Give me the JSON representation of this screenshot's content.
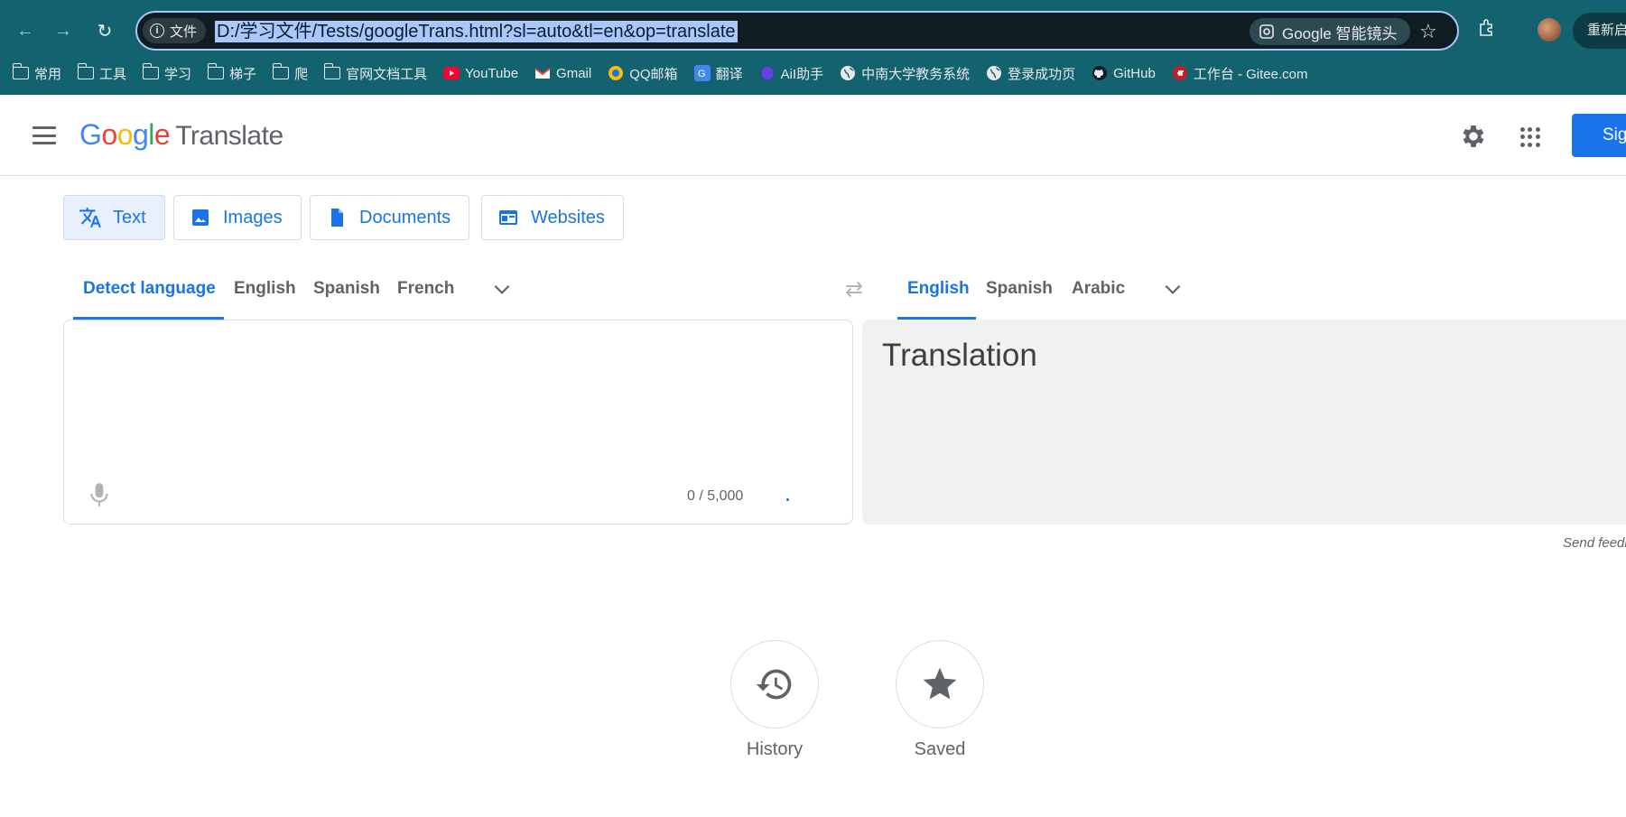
{
  "browser": {
    "url": "D:/学习文件/Tests/googleTrans.html?sl=auto&tl=en&op=translate",
    "site_chip_label": "文件",
    "lens_label": "Google 智能镜头",
    "relaunch_label": "重新启",
    "bookmarks": [
      {
        "label": "常用",
        "icon": "folder-icon"
      },
      {
        "label": "工具",
        "icon": "folder-icon"
      },
      {
        "label": "学习",
        "icon": "folder-icon"
      },
      {
        "label": "梯子",
        "icon": "folder-icon"
      },
      {
        "label": "爬",
        "icon": "folder-icon"
      },
      {
        "label": "官网文档工具",
        "icon": "folder-icon"
      },
      {
        "label": "YouTube",
        "icon": "youtube-icon"
      },
      {
        "label": "Gmail",
        "icon": "gmail-icon"
      },
      {
        "label": "QQ邮箱",
        "icon": "qqmail-icon"
      },
      {
        "label": "翻译",
        "icon": "translate-icon"
      },
      {
        "label": "AiI助手",
        "icon": "assistant-icon"
      },
      {
        "label": "中南大学教务系统",
        "icon": "globe-icon"
      },
      {
        "label": "登录成功页",
        "icon": "globe-icon"
      },
      {
        "label": "GitHub",
        "icon": "github-icon"
      },
      {
        "label": "工作台 - Gitee.com",
        "icon": "gitee-icon"
      }
    ]
  },
  "header": {
    "logo_letters": [
      "G",
      "o",
      "o",
      "g",
      "l",
      "e"
    ],
    "product": "Translate",
    "signin_label": "Sig"
  },
  "modes": [
    {
      "label": "Text",
      "icon": "translate-icon",
      "active": true
    },
    {
      "label": "Images",
      "icon": "image-icon",
      "active": false
    },
    {
      "label": "Documents",
      "icon": "document-icon",
      "active": false
    },
    {
      "label": "Websites",
      "icon": "website-icon",
      "active": false
    }
  ],
  "source_langs": [
    "Detect language",
    "English",
    "Spanish",
    "French"
  ],
  "target_langs": [
    "English",
    "Spanish",
    "Arabic"
  ],
  "source": {
    "counter": "0 / 5,000"
  },
  "target": {
    "placeholder": "Translation",
    "feedback": "Send feedb"
  },
  "bottom": {
    "history_label": "History",
    "saved_label": "Saved"
  },
  "colors": {
    "chrome": "#12636f",
    "accent": "#1a73e8"
  }
}
